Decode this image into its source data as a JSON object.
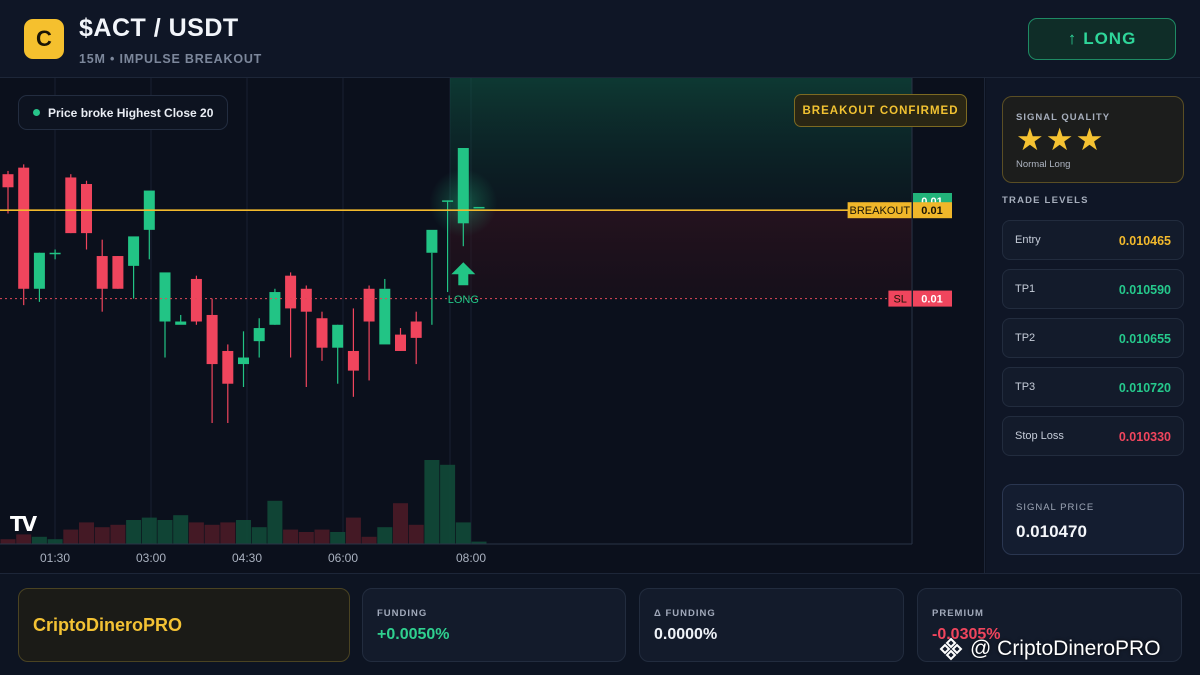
{
  "header": {
    "logo_letter": "C",
    "pair": "$ACT / USDT",
    "subtitle": "15M • IMPULSE BREAKOUT",
    "long_button": {
      "icon": "↑",
      "label": "LONG"
    }
  },
  "chart": {
    "badge_broke": "Price broke Highest Close 20",
    "badge_confirmed": "BREAKOUT CONFIRMED",
    "tv_logo": "TV",
    "long_marker_label": "LONG",
    "price_tags": {
      "top": {
        "value": "0.01",
        "color": "#22b37a"
      },
      "breakout": {
        "label": "BREAKOUT",
        "value": "0.01",
        "color": "#f0b72a"
      },
      "sl": {
        "label": "SL",
        "value": "0.01",
        "color": "#f0455d"
      }
    },
    "time_labels": [
      "01:30",
      "03:00",
      "04:30",
      "06:00",
      "08:00"
    ],
    "colors": {
      "up": "#22c485",
      "down": "#f0455d",
      "breakout_line": "#f2b92c",
      "sl_line": "#e14a5a"
    }
  },
  "chart_data": {
    "type": "candlestick",
    "x": [
      "00:45",
      "01:00",
      "01:15",
      "01:30",
      "01:45",
      "02:00",
      "02:15",
      "02:30",
      "02:45",
      "03:00",
      "03:15",
      "03:30",
      "03:45",
      "04:00",
      "04:15",
      "04:30",
      "04:45",
      "05:00",
      "05:15",
      "05:30",
      "05:45",
      "06:00",
      "06:15",
      "06:30",
      "06:45",
      "07:00",
      "07:15",
      "07:30",
      "07:45",
      "08:00",
      "08:15"
    ],
    "open": [
      0.01052,
      0.01053,
      0.010345,
      0.0104,
      0.010515,
      0.010505,
      0.010395,
      0.010395,
      0.01038,
      0.010435,
      0.010295,
      0.01029,
      0.01036,
      0.010305,
      0.01025,
      0.01023,
      0.010265,
      0.01029,
      0.010365,
      0.010345,
      0.0103,
      0.010255,
      0.01025,
      0.010345,
      0.01026,
      0.010275,
      0.010295,
      0.0104,
      0.01048,
      0.010445,
      0.01047
    ],
    "high": [
      0.010525,
      0.010535,
      0.0104,
      0.010405,
      0.01052,
      0.01051,
      0.01042,
      0.010395,
      0.010395,
      0.01044,
      0.01031,
      0.010305,
      0.010365,
      0.01033,
      0.01026,
      0.01028,
      0.0103,
      0.010345,
      0.01037,
      0.01035,
      0.01031,
      0.01029,
      0.010315,
      0.01035,
      0.01036,
      0.010285,
      0.01031,
      0.0104,
      0.01048,
      0.01054,
      0.01047
    ],
    "low": [
      0.01046,
      0.01032,
      0.010325,
      0.01039,
      0.01043,
      0.010405,
      0.01031,
      0.010345,
      0.01033,
      0.01039,
      0.01024,
      0.010295,
      0.01029,
      0.01014,
      0.01014,
      0.010195,
      0.01024,
      0.01029,
      0.01024,
      0.010195,
      0.010235,
      0.0102,
      0.01018,
      0.010205,
      0.010345,
      0.01025,
      0.01023,
      0.01029,
      0.01034,
      0.01041,
      0.01047
    ],
    "close": [
      0.0105,
      0.010345,
      0.0104,
      0.0104,
      0.01043,
      0.01043,
      0.010345,
      0.010345,
      0.010425,
      0.010495,
      0.01037,
      0.010295,
      0.010295,
      0.01023,
      0.0102,
      0.01024,
      0.010285,
      0.01034,
      0.010315,
      0.01031,
      0.010255,
      0.01029,
      0.01022,
      0.010295,
      0.010345,
      0.01025,
      0.01027,
      0.010435,
      0.01048,
      0.01056,
      0.01047
    ],
    "volume": [
      0.2,
      0.4,
      0.3,
      0.2,
      0.6,
      0.9,
      0.7,
      0.8,
      1.0,
      1.1,
      1.0,
      1.2,
      0.9,
      0.8,
      0.9,
      1.0,
      0.7,
      1.8,
      0.6,
      0.5,
      0.6,
      0.5,
      1.1,
      0.3,
      0.7,
      1.7,
      0.8,
      3.5,
      3.3,
      0.9,
      0.1
    ],
    "breakout_level": 0.010465,
    "stop_loss": 0.01033,
    "xlabel": "",
    "ylabel": ""
  },
  "side": {
    "quality": {
      "label": "SIGNAL QUALITY",
      "stars": "★★★",
      "rating": 3,
      "desc": "Normal Long"
    },
    "levels_title": "TRADE LEVELS",
    "levels": [
      {
        "name": "Entry",
        "value": "0.010465",
        "color": "#f2b92c"
      },
      {
        "name": "TP1",
        "value": "0.010590",
        "color": "#25c98c"
      },
      {
        "name": "TP2",
        "value": "0.010655",
        "color": "#25c98c"
      },
      {
        "name": "TP3",
        "value": "0.010720",
        "color": "#25c98c"
      },
      {
        "name": "Stop Loss",
        "value": "0.010330",
        "color": "#f0455d"
      }
    ],
    "signal_price": {
      "label": "SIGNAL PRICE",
      "value": "0.010470"
    }
  },
  "bottom": {
    "brand": "CriptoDineroPRO",
    "metrics": [
      {
        "label": "FUNDING",
        "value": "+0.0050%",
        "color": "#2fd08f"
      },
      {
        "label": "Δ FUNDING",
        "value": "0.0000%",
        "color": "#eef2f8"
      },
      {
        "label": "PREMIUM",
        "value": "-0.0305%",
        "color": "#f0455d"
      }
    ],
    "watermark": "@ CriptoDineroPRO"
  }
}
